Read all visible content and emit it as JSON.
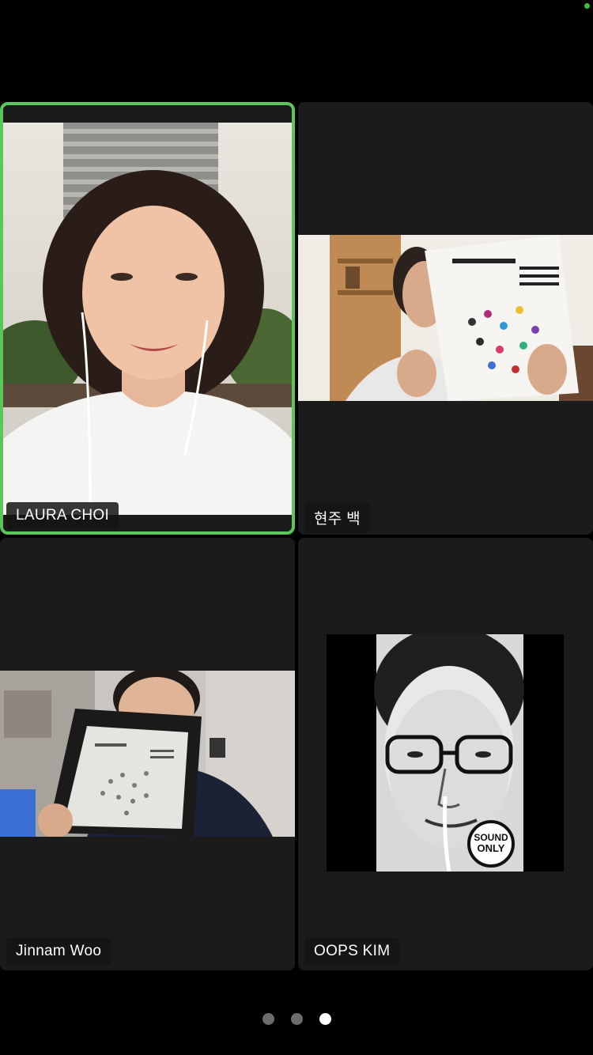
{
  "participants": [
    {
      "name": "LAURA CHOI",
      "active_speaker": true
    },
    {
      "name": "현주 백",
      "active_speaker": false
    },
    {
      "name": "Jinnam Woo",
      "active_speaker": false
    },
    {
      "name": "OOPS KIM",
      "active_speaker": false
    }
  ],
  "sound_only_badge": {
    "line1": "SOUND",
    "line2": "ONLY"
  },
  "pager": {
    "page_count": 3,
    "current_page": 3
  },
  "colors": {
    "active_speaker_border": "#5cc65b",
    "tile_background": "#1b1b1b",
    "status_dot": "#3cc23a"
  }
}
